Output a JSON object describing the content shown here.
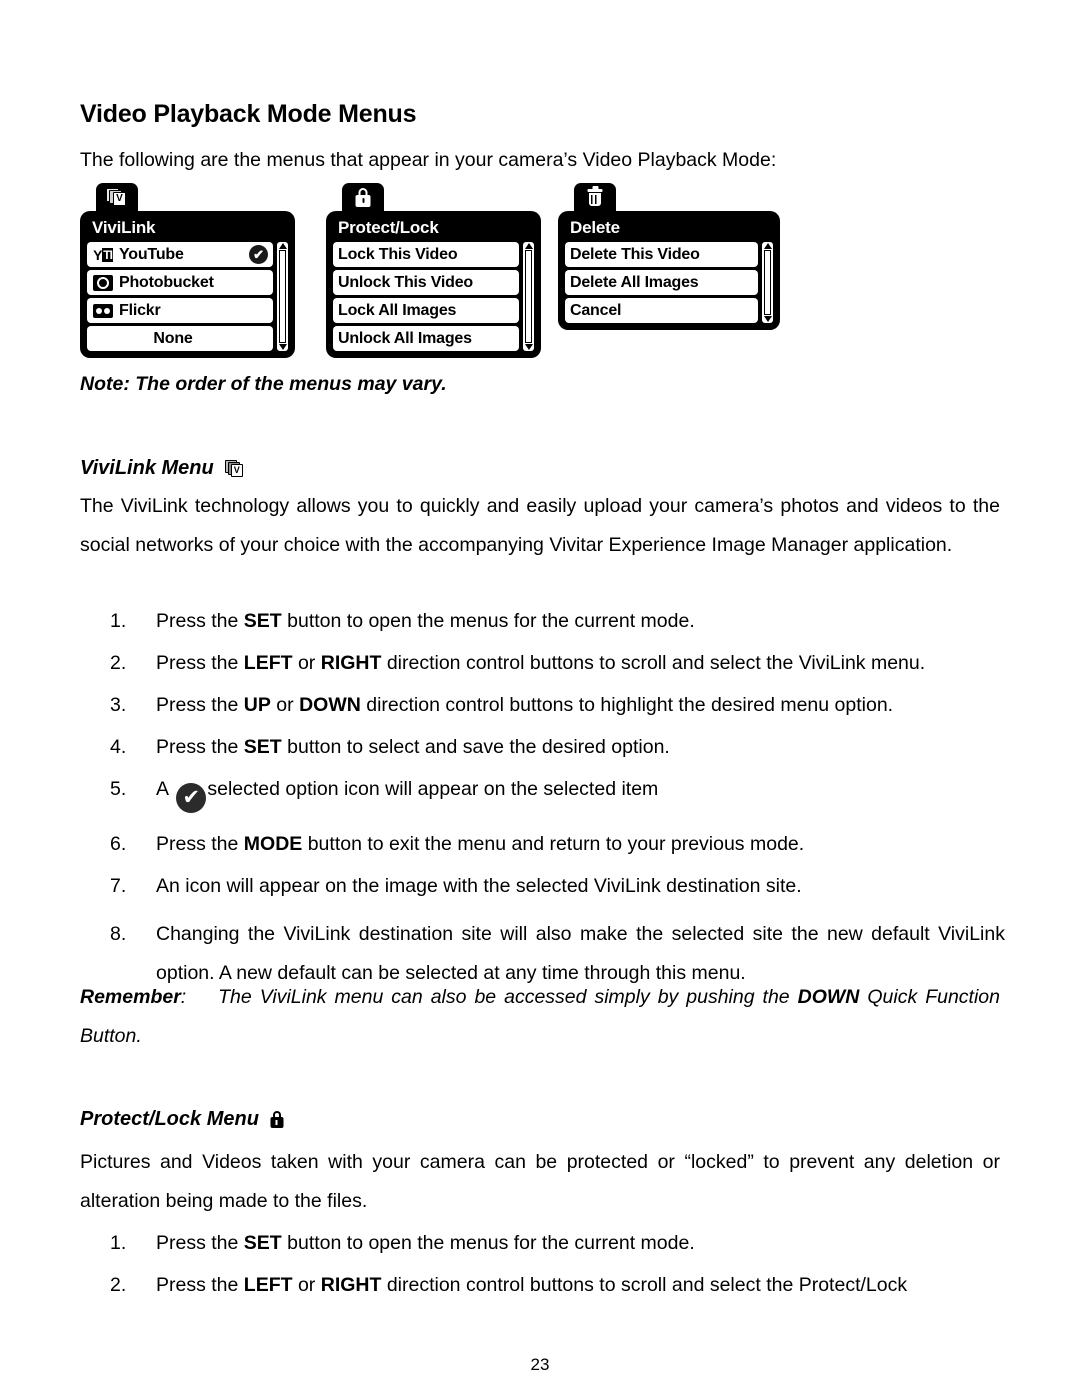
{
  "page": {
    "title": "Video Playback Mode Menus",
    "intro": "The following are the menus that appear in your camera’s Video Playback Mode:",
    "note_label": "Note:",
    "note_text": "The order of the menus may vary.",
    "page_number": "23"
  },
  "menus": [
    {
      "name": "vivilink",
      "tab_icon": "vivilink-stack-icon",
      "header": "ViviLink",
      "items": [
        {
          "label": "YouTube",
          "icon": "youtube-icon",
          "selected": true,
          "centered": false
        },
        {
          "label": "Photobucket",
          "icon": "photobucket-icon",
          "selected": false,
          "centered": false
        },
        {
          "label": "Flickr",
          "icon": "flickr-icon",
          "selected": false,
          "centered": false
        },
        {
          "label": "None",
          "icon": "none",
          "selected": false,
          "centered": true
        }
      ]
    },
    {
      "name": "protect-lock",
      "tab_icon": "lock-icon",
      "header": "Protect/Lock",
      "items": [
        {
          "label": "Lock This Video",
          "icon": "none",
          "selected": false,
          "centered": false
        },
        {
          "label": "Unlock This Video",
          "icon": "none",
          "selected": false,
          "centered": false
        },
        {
          "label": "Lock All Images",
          "icon": "none",
          "selected": false,
          "centered": false
        },
        {
          "label": "Unlock All Images",
          "icon": "none",
          "selected": false,
          "centered": false
        }
      ]
    },
    {
      "name": "delete",
      "tab_icon": "trash-icon",
      "header": "Delete",
      "items": [
        {
          "label": "Delete This Video",
          "icon": "none",
          "selected": false,
          "centered": false
        },
        {
          "label": "Delete All Images",
          "icon": "none",
          "selected": false,
          "centered": false
        },
        {
          "label": "Cancel",
          "icon": "none",
          "selected": false,
          "centered": false
        }
      ]
    }
  ],
  "sections": {
    "vivilink": {
      "heading": "ViviLink Menu",
      "heading_icon": "vivilink-stack-icon",
      "paragraph": "The ViviLink technology allows you to quickly and easily upload your camera’s photos and videos to the social networks of your choice with the accompanying Vivitar Experience Image Manager application.",
      "steps": [
        {
          "num": "1.",
          "pre": "Press the ",
          "bold": "SET",
          "post": " button to open the menus for the current mode."
        },
        {
          "num": "2.",
          "pre": "Press the ",
          "bold": "LEFT",
          "mid": " or ",
          "bold2": "RIGHT",
          "post": " direction control buttons to scroll and select the ViviLink menu."
        },
        {
          "num": "3.",
          "pre": "Press the ",
          "bold": "UP",
          "mid": " or ",
          "bold2": "DOWN",
          "post": " direction control buttons to highlight the desired menu option."
        },
        {
          "num": "4.",
          "pre": "Press the ",
          "bold": "SET",
          "post": " button to select and save the desired option."
        },
        {
          "num": "5.",
          "pre": "A ",
          "icon": "check-circle-icon",
          "post": "selected option icon will appear on the selected item"
        },
        {
          "num": "6.",
          "pre": "Press the ",
          "bold": "MODE",
          "post": " button to exit the menu and return to your previous mode."
        },
        {
          "num": "7.",
          "pre": "An icon will appear on the image with the selected ViviLink destination site.",
          "post": ""
        },
        {
          "num": "8.",
          "pre": "Changing the ViviLink destination site will also make the selected site the new default ViviLink option. A new default can be selected at any time through this menu.",
          "post": ""
        }
      ],
      "remember_label": "Remember",
      "remember_sep": ":",
      "remember_pre": "The ViviLink menu can also be accessed simply by pushing the ",
      "remember_bold": "DOWN",
      "remember_post": " Quick Function Button."
    },
    "protect": {
      "heading": "Protect/Lock Menu",
      "heading_icon": "lock-icon",
      "paragraph": "Pictures and Videos taken with your camera can be protected or “locked” to prevent any deletion or alteration being made to the files.",
      "steps": [
        {
          "num": "1.",
          "pre": "Press the ",
          "bold": "SET",
          "post": " button to open the menus for the current mode."
        },
        {
          "num": "2.",
          "pre": "Press the ",
          "bold": "LEFT",
          "mid": " or ",
          "bold2": "RIGHT",
          "post": " direction control buttons to scroll and select the Protect/Lock"
        }
      ]
    }
  },
  "icons": {
    "check_glyph": "✔",
    "youtube_y": "Y",
    "youtube_box": "TI",
    "vivilink_letter": "V"
  },
  "colors": {
    "page_bg": "#ffffff",
    "text": "#000000",
    "menu_bg": "#000000",
    "menu_row_bg": "#ffffff"
  }
}
